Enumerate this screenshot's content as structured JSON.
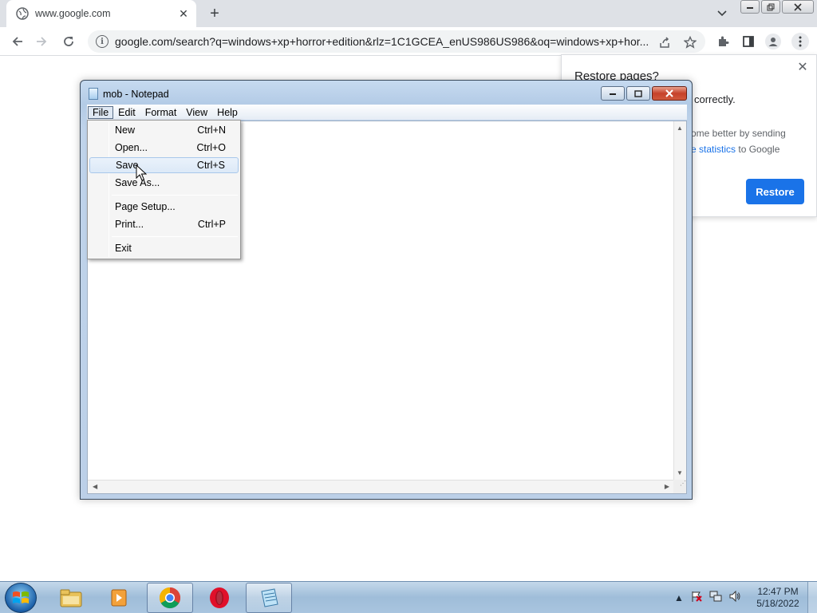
{
  "browser": {
    "tab_title": "www.google.com",
    "new_tab": "+",
    "tab_close": "✕",
    "url": "google.com/search?q=windows+xp+horror+edition&rlz=1C1GCEA_enUS986US986&oq=windows+xp+hor...",
    "info_symbol": "i"
  },
  "restore_bubble": {
    "title": "Restore pages?",
    "message": "correctly.",
    "note_prefix": "ome better by sending",
    "note_link": "e statistics",
    "note_suffix": "to Google",
    "button": "Restore",
    "close": "✕"
  },
  "notepad": {
    "title": "mob - Notepad",
    "menus": [
      "File",
      "Edit",
      "Format",
      "View",
      "Help"
    ],
    "file_menu": {
      "new": {
        "label": "New",
        "key": "Ctrl+N"
      },
      "open": {
        "label": "Open...",
        "key": "Ctrl+O"
      },
      "save": {
        "label": "Save",
        "key": "Ctrl+S"
      },
      "save_as": {
        "label": "Save As...",
        "key": ""
      },
      "page_setup": {
        "label": "Page Setup...",
        "key": ""
      },
      "print": {
        "label": "Print...",
        "key": "Ctrl+P"
      },
      "exit": {
        "label": "Exit",
        "key": ""
      }
    }
  },
  "taskbar": {
    "time": "12:47 PM",
    "date": "5/18/2022"
  },
  "colors": {
    "accent": "#1a73e8",
    "menu_hover": "#dce9f7"
  }
}
